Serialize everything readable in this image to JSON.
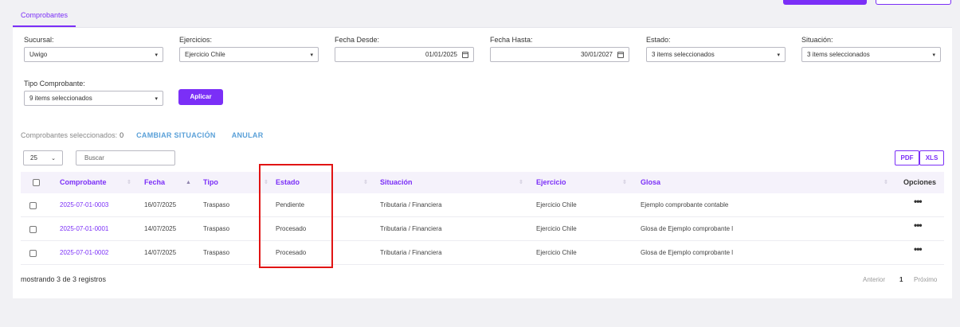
{
  "tabs": [
    {
      "label": "Comprobantes"
    }
  ],
  "filters": {
    "sucursal": {
      "label": "Sucursal:",
      "value": "Uwigo"
    },
    "ejercicios": {
      "label": "Ejercicios:",
      "value": "Ejercicio Chile"
    },
    "fecha_desde": {
      "label": "Fecha Desde:",
      "value": "01/01/2025"
    },
    "fecha_hasta": {
      "label": "Fecha Hasta:",
      "value": "30/01/2027"
    },
    "estado": {
      "label": "Estado:",
      "value": "3 items seleccionados"
    },
    "situacion": {
      "label": "Situación:",
      "value": "3 items seleccionados"
    },
    "tipo_comprobante": {
      "label": "Tipo Comprobante:",
      "value": "9 items seleccionados"
    },
    "apply_label": "Aplicar"
  },
  "selection": {
    "label": "Comprobantes seleccionados:",
    "count": "0",
    "change_status": "CAMBIAR SITUACIÓN",
    "void": "ANULAR"
  },
  "toolbar": {
    "page_size": "25",
    "search_placeholder": "Buscar",
    "pdf": "PDF",
    "xls": "XLS"
  },
  "table": {
    "headers": {
      "comprobante": "Comprobante",
      "fecha": "Fecha",
      "tipo": "Tipo",
      "estado": "Estado",
      "situacion": "Situación",
      "ejercicio": "Ejercicio",
      "glosa": "Glosa",
      "opciones": "Opciones"
    },
    "rows": [
      {
        "comprobante": "2025-07-01-0003",
        "fecha": "16/07/2025",
        "tipo": "Traspaso",
        "estado": "Pendiente",
        "situacion": "Tributaria / Financiera",
        "ejercicio": "Ejercicio Chile",
        "glosa": "Ejemplo comprobante contable"
      },
      {
        "comprobante": "2025-07-01-0001",
        "fecha": "14/07/2025",
        "tipo": "Traspaso",
        "estado": "Procesado",
        "situacion": "Tributaria / Financiera",
        "ejercicio": "Ejercicio Chile",
        "glosa": "Glosa de Ejemplo comprobante l"
      },
      {
        "comprobante": "2025-07-01-0002",
        "fecha": "14/07/2025",
        "tipo": "Traspaso",
        "estado": "Procesado",
        "situacion": "Tributaria / Financiera",
        "ejercicio": "Ejercicio Chile",
        "glosa": "Glosa de Ejemplo comprobante l"
      }
    ],
    "options_glyph": "•••"
  },
  "footer": {
    "summary": "mostrando 3 de 3 registros",
    "prev": "Anterior",
    "page": "1",
    "next": "Próximo"
  },
  "icons": {
    "caret": "caret-down-icon",
    "calendar": "calendar-icon",
    "sort": "sort-icon",
    "more": "more-horizontal-icon"
  },
  "colors": {
    "accent": "#7b2ff7",
    "link": "#5aa0d8",
    "highlight": "#e11414",
    "header_bg": "#f5f2fb"
  }
}
